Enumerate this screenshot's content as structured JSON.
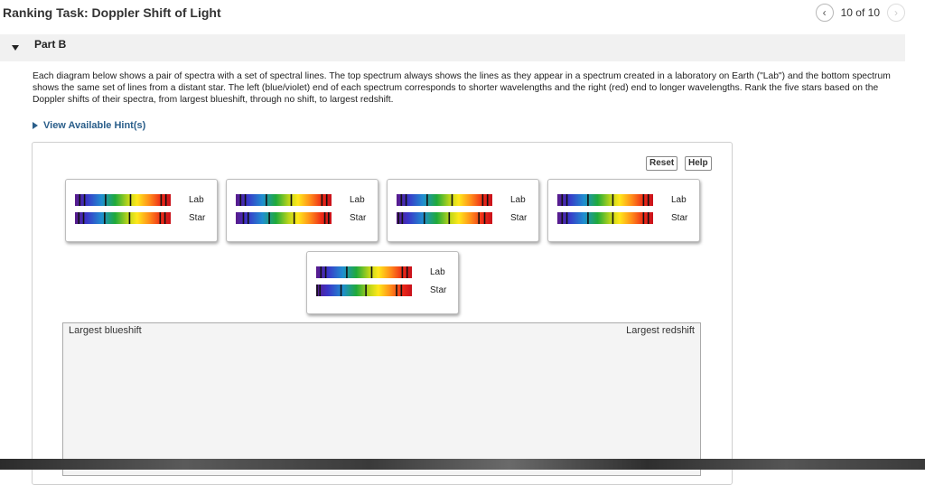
{
  "header": {
    "title": "Ranking Task: Doppler Shift of Light",
    "pager_text": "10 of 10"
  },
  "part": {
    "label": "Part B"
  },
  "description": "Each diagram below shows a pair of spectra with a set of spectral lines. The top spectrum always shows the lines as they appear in a spectrum created in a laboratory on Earth (\"Lab\") and the bottom spectrum shows the same set of lines from a distant star. The left (blue/violet) end of each spectrum corresponds to shorter wavelengths and the right (red) end to longer wavelengths. Rank the five stars based on the Doppler shifts of their spectra, from largest blueshift, through no shift, to largest redshift.",
  "hint_link": "View Available Hint(s)",
  "buttons": {
    "reset": "Reset",
    "help": "Help"
  },
  "spectrum_labels": {
    "lab": "Lab",
    "star": "Star"
  },
  "lab_lines": [
    0.05,
    0.1,
    0.32,
    0.58,
    0.9,
    0.95
  ],
  "cards": [
    {
      "id": 1,
      "star_lines": [
        0.04,
        0.09,
        0.31,
        0.57,
        0.89,
        0.94
      ]
    },
    {
      "id": 2,
      "star_lines": [
        0.08,
        0.13,
        0.35,
        0.61,
        0.93,
        0.97
      ]
    },
    {
      "id": 3,
      "star_lines": [
        0.02,
        0.06,
        0.29,
        0.55,
        0.86,
        0.92
      ]
    },
    {
      "id": 4,
      "star_lines": [
        0.05,
        0.1,
        0.32,
        0.58,
        0.9,
        0.95
      ]
    },
    {
      "id": 5,
      "star_lines": [
        0.01,
        0.04,
        0.26,
        0.52,
        0.84,
        0.89
      ]
    }
  ],
  "ranking": {
    "left_label": "Largest blueshift",
    "right_label": "Largest redshift"
  },
  "colors": {
    "hint_link": "#2a5e8a",
    "panel_border": "#cfcfcf",
    "rank_bg": "#f4f4f4"
  },
  "icons": {
    "prev": "chevron-left-icon",
    "next": "chevron-right-icon",
    "expand": "triangle-down-icon",
    "hint": "triangle-right-icon"
  }
}
